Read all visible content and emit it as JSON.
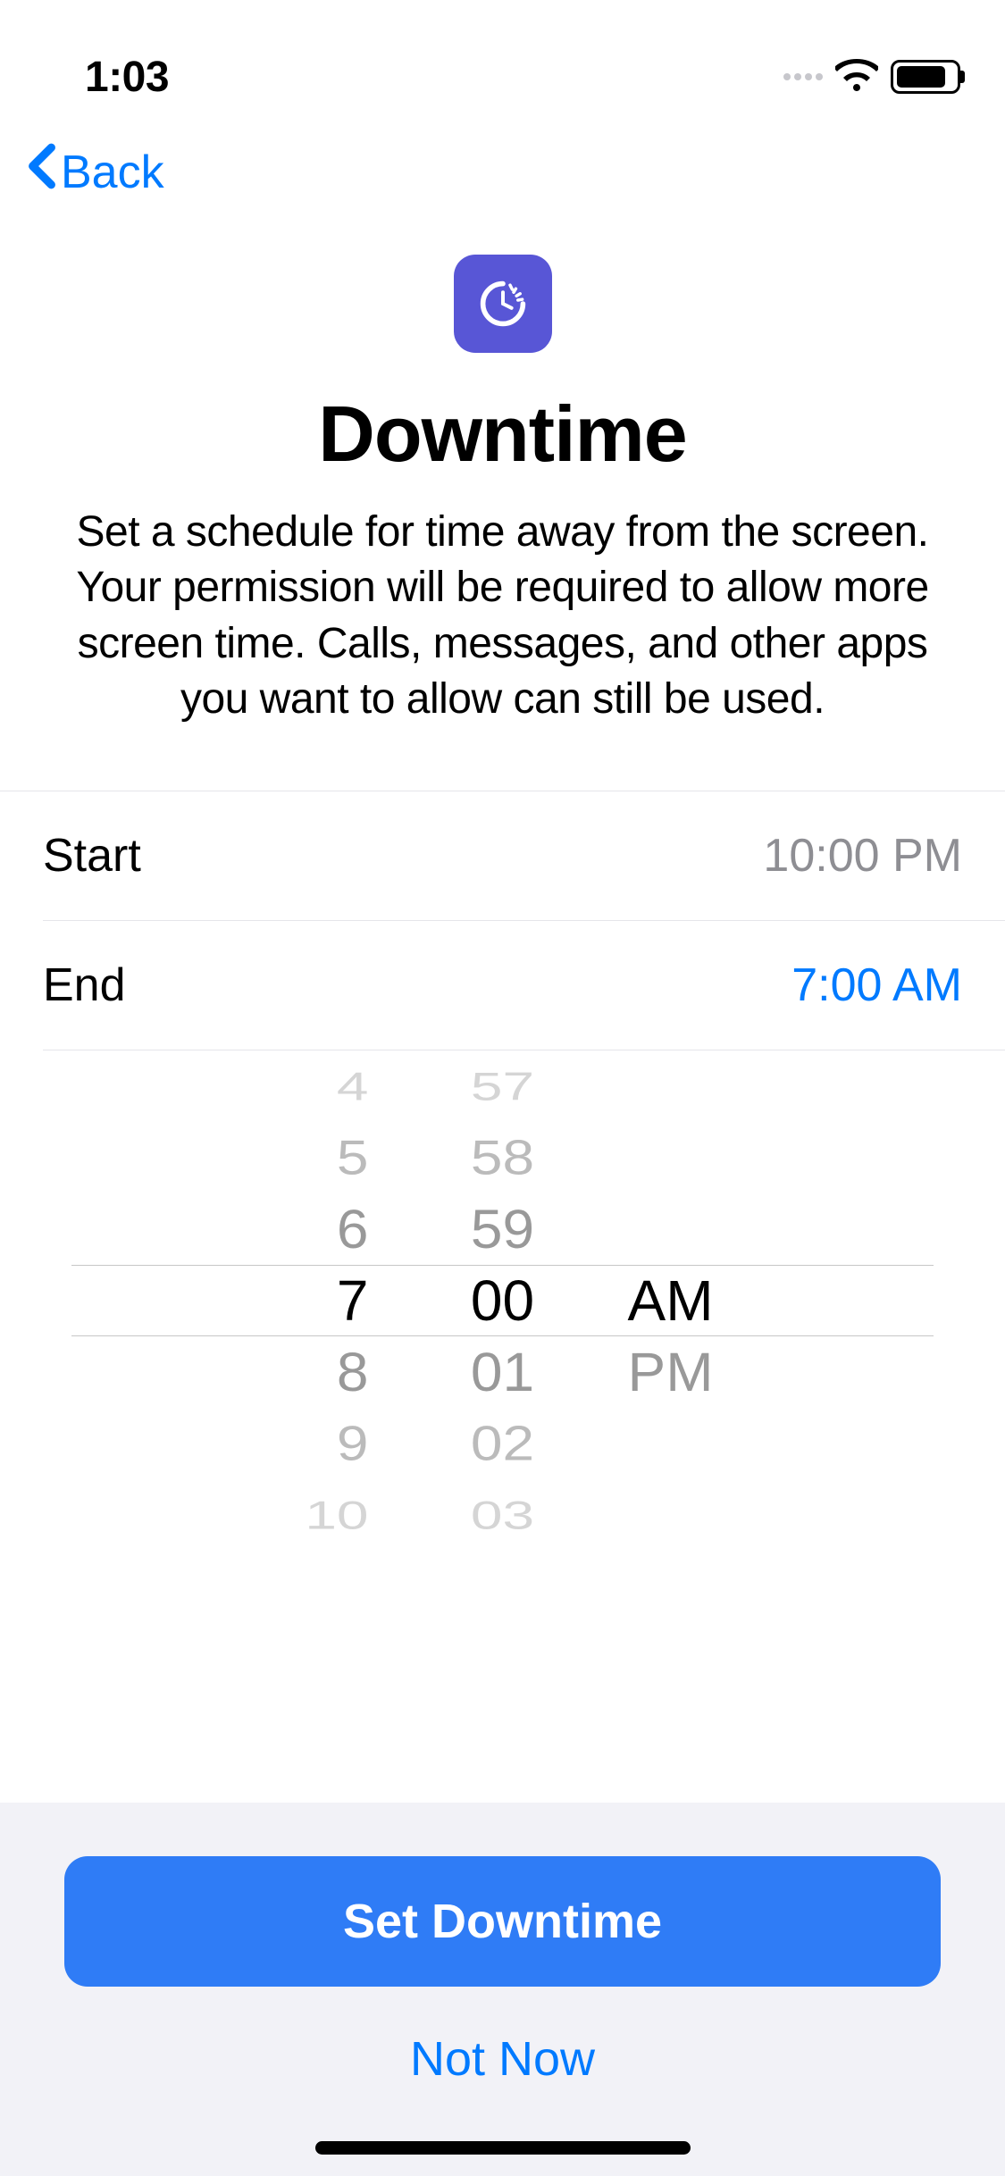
{
  "status": {
    "time": "1:03"
  },
  "nav": {
    "back_label": "Back"
  },
  "header": {
    "title": "Downtime",
    "description": "Set a schedule for time away from the screen. Your permission will be required to allow more screen time. Calls, messages, and other apps you want to allow can still be used."
  },
  "schedule": {
    "start_label": "Start",
    "start_value": "10:00 PM",
    "end_label": "End",
    "end_value": "7:00 AM"
  },
  "picker": {
    "hours": [
      "4",
      "5",
      "6",
      "7",
      "8",
      "9",
      "10"
    ],
    "minutes": [
      "57",
      "58",
      "59",
      "00",
      "01",
      "02",
      "03"
    ],
    "ampm": [
      "AM",
      "PM"
    ],
    "selected_hour": "7",
    "selected_minute": "00",
    "selected_ampm": "AM"
  },
  "buttons": {
    "primary": "Set Downtime",
    "secondary": "Not Now"
  }
}
